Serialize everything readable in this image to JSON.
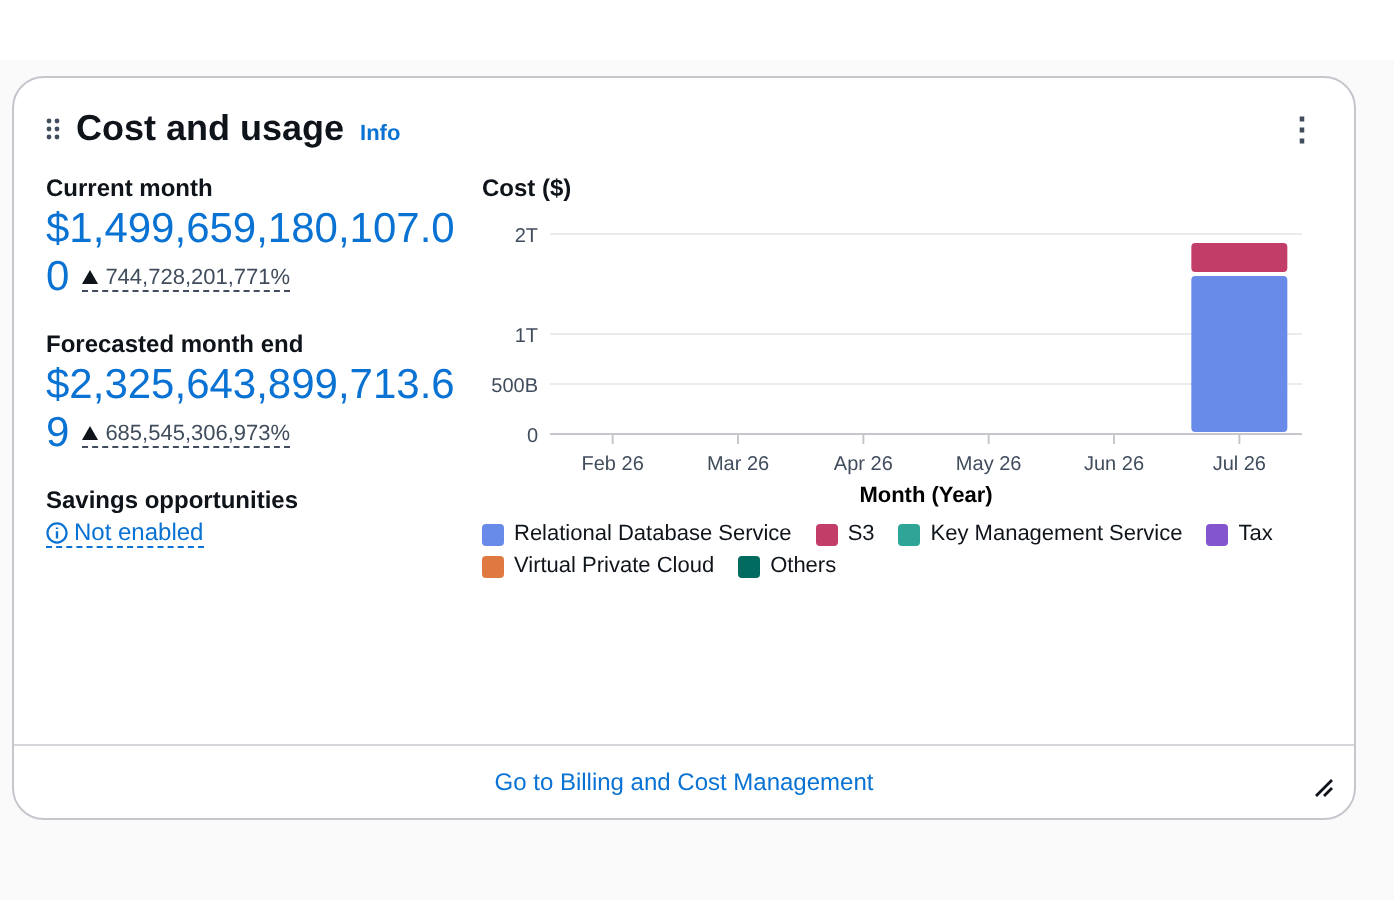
{
  "widget": {
    "title": "Cost and usage",
    "info_link": "Info",
    "menu_icon": "⋮"
  },
  "metrics": [
    {
      "label": "Current month",
      "value_lines": [
        "$1,499,659,180,107.0",
        "0"
      ],
      "change": "744,728,201,771%"
    },
    {
      "label": "Forecasted month end",
      "value_lines": [
        "$2,325,643,899,713.6",
        "9"
      ],
      "change": "685,545,306,973%"
    }
  ],
  "savings": {
    "label": "Savings opportunities",
    "status": "Not enabled"
  },
  "chart": {
    "chart_data": {
      "type": "bar",
      "stacked": true,
      "ylabel": "Cost ($)",
      "xlabel": "Month (Year)",
      "ylim": [
        0,
        2000000000000
      ],
      "categories": [
        "Feb 26",
        "Mar 26",
        "Apr 26",
        "May 26",
        "Jun 26",
        "Jul 26"
      ],
      "yticks": [
        {
          "value": 0,
          "label": "0"
        },
        {
          "value": 500000000000,
          "label": "500B"
        },
        {
          "value": 1000000000000,
          "label": "1T"
        },
        {
          "value": 2000000000000,
          "label": "2T"
        }
      ],
      "series": [
        {
          "name": "Relational Database Service",
          "color": "#688ae8",
          "values": [
            0,
            0,
            0,
            0,
            0,
            1600000000000
          ]
        },
        {
          "name": "S3",
          "color": "#c33d69",
          "values": [
            0,
            0,
            0,
            0,
            0,
            330000000000
          ]
        },
        {
          "name": "Key Management Service",
          "color": "#2ea597",
          "values": [
            0,
            0,
            0,
            0,
            0,
            0
          ]
        },
        {
          "name": "Tax",
          "color": "#8456ce",
          "values": [
            0,
            0,
            0,
            0,
            0,
            0
          ]
        },
        {
          "name": "Virtual Private Cloud",
          "color": "#e07941",
          "values": [
            0,
            0,
            0,
            0,
            0,
            0
          ]
        },
        {
          "name": "Others",
          "color": "#016b5f",
          "values": [
            0,
            0,
            0,
            0,
            0,
            0
          ]
        }
      ]
    }
  },
  "footer": {
    "link": "Go to Billing and Cost Management"
  }
}
